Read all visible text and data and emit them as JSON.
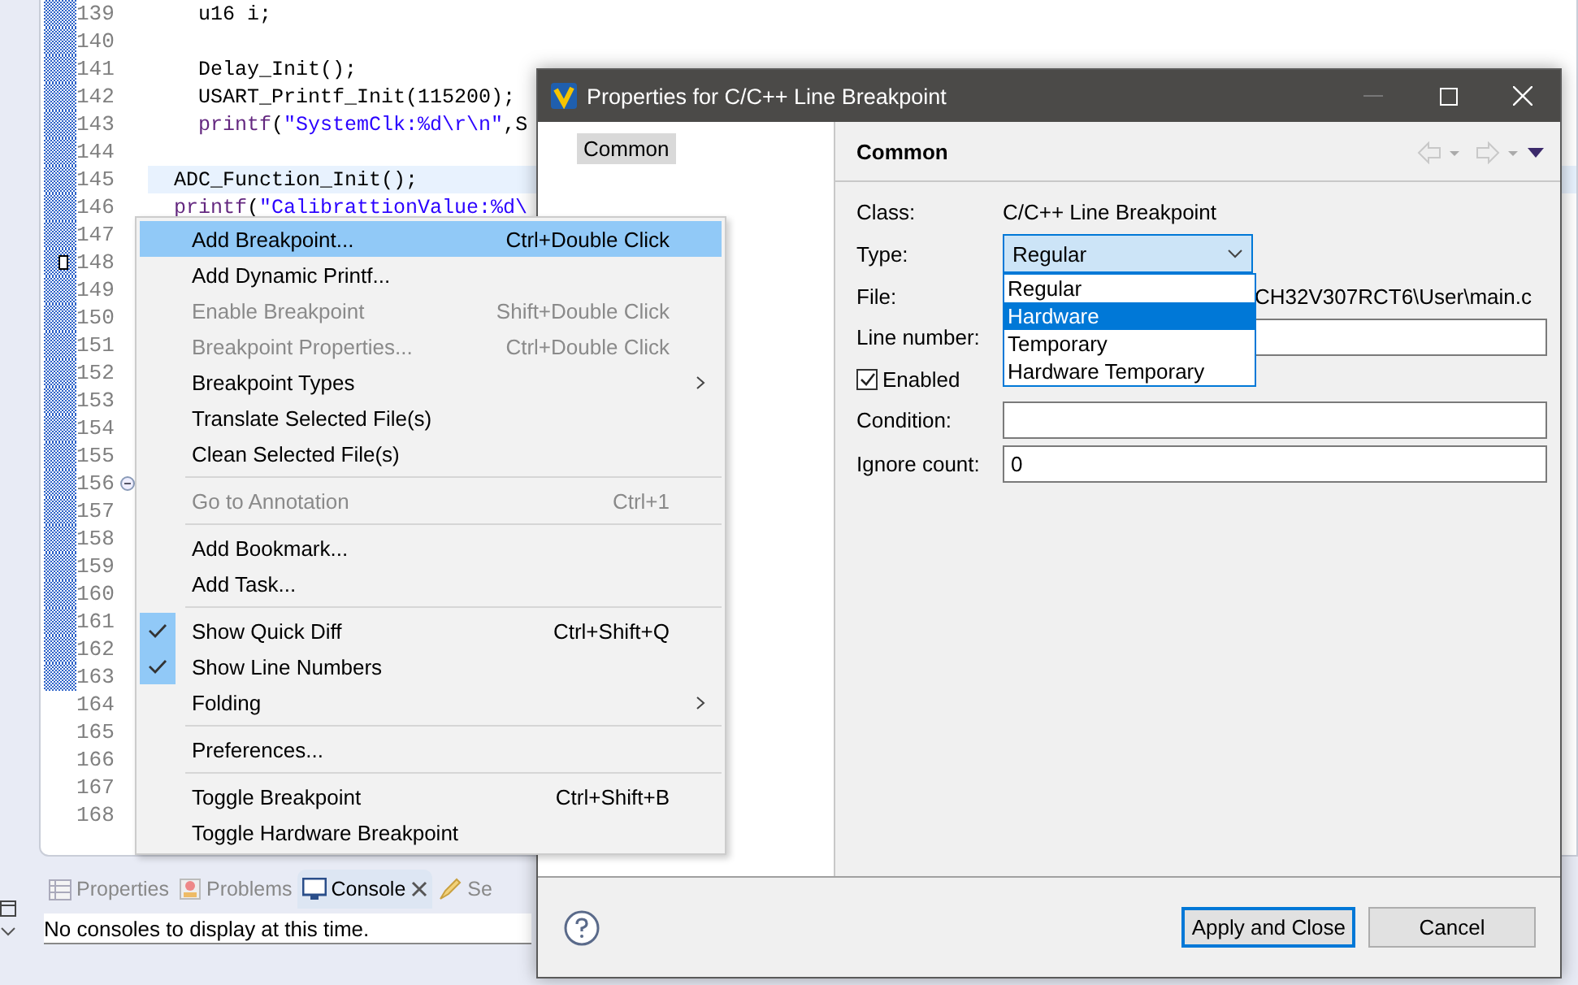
{
  "editor": {
    "lines": [
      {
        "number": "139",
        "changed": true,
        "current": false,
        "annotation": false,
        "fold": false,
        "code": [
          {
            "kind": "plain",
            "text": "  u16 i;"
          }
        ]
      },
      {
        "number": "140",
        "changed": true,
        "current": false,
        "annotation": false,
        "fold": false
      },
      {
        "number": "141",
        "changed": true,
        "current": false,
        "annotation": false,
        "fold": false,
        "code": [
          {
            "kind": "plain",
            "text": "  Delay_Init();"
          }
        ]
      },
      {
        "number": "142",
        "changed": true,
        "current": false,
        "annotation": false,
        "fold": false,
        "code": [
          {
            "kind": "plain",
            "text": "  USART_Printf_Init(115200);"
          }
        ]
      },
      {
        "number": "143",
        "changed": true,
        "current": false,
        "annotation": false,
        "fold": false,
        "code": [
          {
            "kind": "func",
            "text": "  printf"
          },
          {
            "kind": "plain",
            "text": "("
          },
          {
            "kind": "string",
            "text": "\"SystemClk:%d\\r\\n\""
          },
          {
            "kind": "plain",
            "text": ",S"
          }
        ]
      },
      {
        "number": "144",
        "changed": true,
        "current": false,
        "annotation": false,
        "fold": false
      },
      {
        "number": "145",
        "changed": true,
        "current": true,
        "annotation": false,
        "fold": false,
        "code": [
          {
            "kind": "plain",
            "text": "ADC_Function_Init();"
          }
        ]
      },
      {
        "number": "146",
        "changed": true,
        "current": false,
        "annotation": false,
        "fold": false,
        "code": [
          {
            "kind": "func",
            "text": "printf"
          },
          {
            "kind": "plain",
            "text": "("
          },
          {
            "kind": "string",
            "text": "\"CalibrattionValue:%d\\"
          }
        ]
      },
      {
        "number": "147",
        "changed": true,
        "current": false,
        "annotation": false,
        "fold": false
      },
      {
        "number": "148",
        "changed": true,
        "current": false,
        "annotation": true,
        "fold": false
      },
      {
        "number": "149",
        "changed": true,
        "current": false,
        "annotation": false,
        "fold": false
      },
      {
        "number": "150",
        "changed": true,
        "current": false,
        "annotation": false,
        "fold": false
      },
      {
        "number": "151",
        "changed": true,
        "current": false,
        "annotation": false,
        "fold": false
      },
      {
        "number": "152",
        "changed": true,
        "current": false,
        "annotation": false,
        "fold": false
      },
      {
        "number": "153",
        "changed": true,
        "current": false,
        "annotation": false,
        "fold": false
      },
      {
        "number": "154",
        "changed": true,
        "current": false,
        "annotation": false,
        "fold": false
      },
      {
        "number": "155",
        "changed": true,
        "current": false,
        "annotation": false,
        "fold": false
      },
      {
        "number": "156",
        "changed": true,
        "current": false,
        "annotation": false,
        "fold": true
      },
      {
        "number": "157",
        "changed": true,
        "current": false,
        "annotation": false,
        "fold": false
      },
      {
        "number": "158",
        "changed": true,
        "current": false,
        "annotation": false,
        "fold": false
      },
      {
        "number": "159",
        "changed": true,
        "current": false,
        "annotation": false,
        "fold": false
      },
      {
        "number": "160",
        "changed": true,
        "current": false,
        "annotation": false,
        "fold": false
      },
      {
        "number": "161",
        "changed": true,
        "current": false,
        "annotation": false,
        "fold": false
      },
      {
        "number": "162",
        "changed": true,
        "current": false,
        "annotation": false,
        "fold": false
      },
      {
        "number": "163",
        "changed": true,
        "current": false,
        "annotation": false,
        "fold": false
      },
      {
        "number": "164",
        "changed": false,
        "current": false,
        "annotation": false,
        "fold": false
      },
      {
        "number": "165",
        "changed": false,
        "current": false,
        "annotation": false,
        "fold": false
      },
      {
        "number": "166",
        "changed": false,
        "current": false,
        "annotation": false,
        "fold": false
      },
      {
        "number": "167",
        "changed": false,
        "current": false,
        "annotation": false,
        "fold": false
      },
      {
        "number": "168",
        "changed": false,
        "current": false,
        "annotation": false,
        "fold": false
      }
    ]
  },
  "context_menu": {
    "items": [
      {
        "kind": "item",
        "label": "Add Breakpoint...",
        "shortcut": "Ctrl+Double Click",
        "disabled": false,
        "checked": false,
        "selected": true,
        "submenu": false
      },
      {
        "kind": "item",
        "label": "Add Dynamic Printf...",
        "disabled": false,
        "checked": false,
        "selected": false,
        "submenu": false
      },
      {
        "kind": "item",
        "label": "Enable Breakpoint",
        "shortcut": "Shift+Double Click",
        "disabled": true,
        "checked": false,
        "selected": false,
        "submenu": false
      },
      {
        "kind": "item",
        "label": "Breakpoint Properties...",
        "shortcut": "Ctrl+Double Click",
        "disabled": true,
        "checked": false,
        "selected": false,
        "submenu": false
      },
      {
        "kind": "item",
        "label": "Breakpoint Types",
        "disabled": false,
        "checked": false,
        "selected": false,
        "submenu": true
      },
      {
        "kind": "item",
        "label": "Translate Selected File(s)",
        "disabled": false,
        "checked": false,
        "selected": false,
        "submenu": false
      },
      {
        "kind": "item",
        "label": "Clean Selected File(s)",
        "disabled": false,
        "checked": false,
        "selected": false,
        "submenu": false
      },
      {
        "kind": "separator"
      },
      {
        "kind": "item",
        "label": "Go to Annotation",
        "shortcut": "Ctrl+1",
        "disabled": true,
        "checked": false,
        "selected": false,
        "submenu": false
      },
      {
        "kind": "separator"
      },
      {
        "kind": "item",
        "label": "Add Bookmark...",
        "disabled": false,
        "checked": false,
        "selected": false,
        "submenu": false
      },
      {
        "kind": "item",
        "label": "Add Task...",
        "disabled": false,
        "checked": false,
        "selected": false,
        "submenu": false
      },
      {
        "kind": "separator"
      },
      {
        "kind": "item",
        "label": "Show Quick Diff",
        "shortcut": "Ctrl+Shift+Q",
        "disabled": false,
        "checked": true,
        "selected": false,
        "submenu": false
      },
      {
        "kind": "item",
        "label": "Show Line Numbers",
        "disabled": false,
        "checked": true,
        "selected": false,
        "submenu": false
      },
      {
        "kind": "item",
        "label": "Folding",
        "disabled": false,
        "checked": false,
        "selected": false,
        "submenu": true
      },
      {
        "kind": "separator"
      },
      {
        "kind": "item",
        "label": "Preferences...",
        "disabled": false,
        "checked": false,
        "selected": false,
        "submenu": false
      },
      {
        "kind": "separator"
      },
      {
        "kind": "item",
        "label": "Toggle Breakpoint",
        "shortcut": "Ctrl+Shift+B",
        "disabled": false,
        "checked": false,
        "selected": false,
        "submenu": false
      },
      {
        "kind": "item",
        "label": "Toggle Hardware Breakpoint",
        "disabled": false,
        "checked": false,
        "selected": false,
        "submenu": false
      }
    ]
  },
  "bottom_panel": {
    "tabs": [
      {
        "label": "Properties",
        "selected": false
      },
      {
        "label": "Problems",
        "selected": false
      },
      {
        "label": "Console",
        "selected": true
      },
      {
        "label": "Se",
        "selected": false
      }
    ],
    "message": "No consoles to display at this time."
  },
  "dialog": {
    "title": "Properties for C/C++ Line Breakpoint",
    "nav_items": [
      {
        "label": "Common",
        "selected": true
      }
    ],
    "page_title": "Common",
    "fields": [
      {
        "kind": "text",
        "label": "Class:",
        "value": "C/C++ Line Breakpoint"
      },
      {
        "kind": "combo",
        "label": "Type:",
        "value": "Regular",
        "expanded": true,
        "options": [
          {
            "label": "Regular",
            "highlighted": false
          },
          {
            "label": "Hardware",
            "highlighted": true
          },
          {
            "label": "Temporary",
            "highlighted": false
          },
          {
            "label": "Hardware Temporary",
            "highlighted": false
          }
        ]
      },
      {
        "kind": "partial_text",
        "label": "File:",
        "value": "CH32V307RCT6\\User\\main.c"
      },
      {
        "kind": "partial_input",
        "label": "Line number:"
      },
      {
        "kind": "checkbox",
        "label": "Enabled",
        "checked": true
      },
      {
        "kind": "input",
        "label": "Condition:"
      },
      {
        "kind": "input",
        "label": "Ignore count:",
        "value": "0"
      }
    ],
    "buttons": [
      {
        "label": "Apply and Close",
        "default": true
      },
      {
        "label": "Cancel",
        "default": false
      }
    ]
  }
}
